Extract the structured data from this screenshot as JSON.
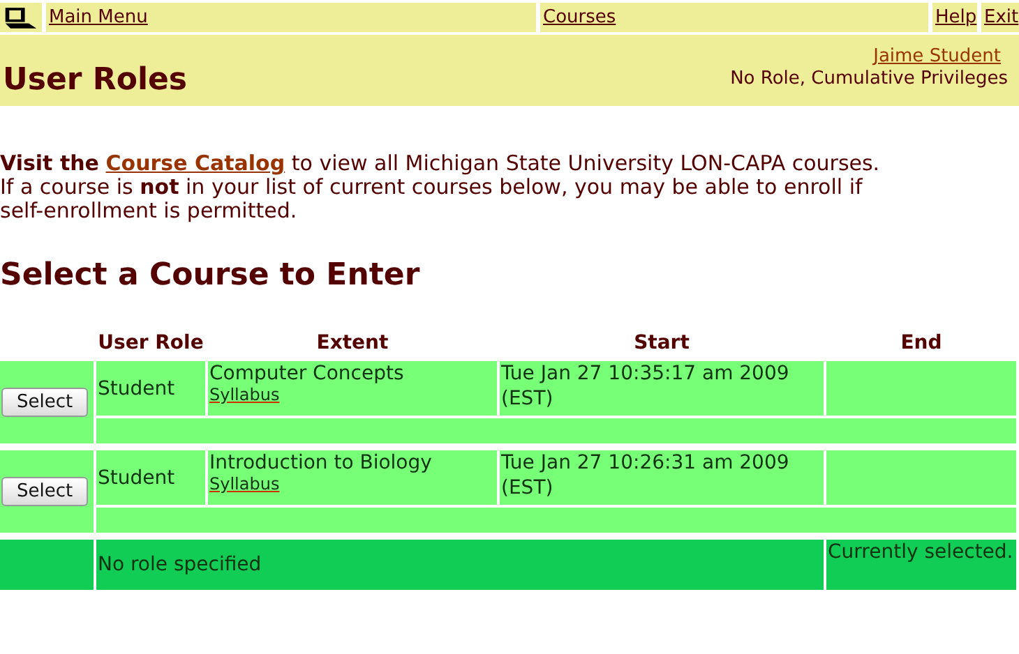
{
  "nav": {
    "links": [
      {
        "label": "Main Menu"
      },
      {
        "label": "Courses"
      },
      {
        "label": "Help"
      },
      {
        "label": "Exit"
      }
    ]
  },
  "header": {
    "title": "User Roles",
    "user": "Jaime Student",
    "role": "No Role, Cumulative Privileges"
  },
  "intro": {
    "lead": "Visit the",
    "link": "Course Catalog",
    "rest": "to view all Michigan State University LON-CAPA courses.",
    "note": "If a course is **not** in your list of current courses below, you may be able to enroll if self-enrollment is permitted."
  },
  "section_title": "Select a Course to Enter",
  "table": {
    "columns": [
      "User Role",
      "Extent",
      "Start",
      "End"
    ],
    "rows": [
      {
        "kind": "course",
        "selected": false,
        "button": "Select",
        "role": "Student",
        "extent": "Computer Concepts",
        "link": "Syllabus",
        "start": "Tue Jan 27 10:35:17 am 2009 (EST)",
        "end": ""
      },
      {
        "kind": "course",
        "selected": false,
        "button": "Select",
        "role": "Student",
        "extent": "Introduction to Biology",
        "link": "Syllabus",
        "start": "Tue Jan 27 10:26:31 am 2009 (EST)",
        "end": ""
      },
      {
        "kind": "current",
        "selected": true,
        "role": "No role specified",
        "end": "Currently selected."
      }
    ]
  }
}
